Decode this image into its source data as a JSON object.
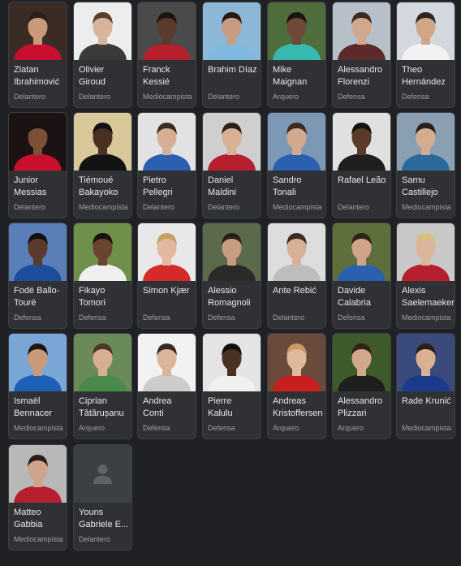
{
  "players": [
    {
      "name": "Zlatan\nIbrahimović",
      "role": "Delantero",
      "bg": "#3a2b24",
      "kit": "#c8102e",
      "skin": "#c89a7a",
      "hair": "#2a1f1a"
    },
    {
      "name": "Olivier\nGiroud",
      "role": "Delantero",
      "bg": "#ededed",
      "kit": "#3a3a3a",
      "skin": "#d8b49a",
      "hair": "#5a3d2b"
    },
    {
      "name": "Franck\nKessié",
      "role": "Mediocampista",
      "bg": "#4a4a4a",
      "kit": "#b51f2e",
      "skin": "#5a3a2a",
      "hair": "#1c1410"
    },
    {
      "name": "Brahim Díaz",
      "role": "Delantero",
      "bg": "#8db7d6",
      "kit": "#7fb8e0",
      "skin": "#c89c82",
      "hair": "#231a15"
    },
    {
      "name": "Mike\nMaignan",
      "role": "Arquero",
      "bg": "#4f6c3c",
      "kit": "#37b9b0",
      "skin": "#6e4a36",
      "hair": "#1a1410"
    },
    {
      "name": "Alessandro\nFlorenzi",
      "role": "Defensa",
      "bg": "#b7c0c8",
      "kit": "#5c2a2a",
      "skin": "#d2a88c",
      "hair": "#3a2a1f"
    },
    {
      "name": "Theo\nHernández",
      "role": "Defensa",
      "bg": "#d3d8de",
      "kit": "#f2f2f2",
      "skin": "#d0a688",
      "hair": "#2f2520"
    },
    {
      "name": "Junior\nMessias",
      "role": "Delantero",
      "bg": "#1b1214",
      "kit": "#c8102e",
      "skin": "#7a5036",
      "hair": "#1a120e"
    },
    {
      "name": "Tiémoué\nBakayoko",
      "role": "Mediocampista",
      "bg": "#d8c89a",
      "kit": "#121212",
      "skin": "#4a3022",
      "hair": "#141010"
    },
    {
      "name": "Pietro\nPellegri",
      "role": "Delantero",
      "bg": "#e2e2e2",
      "kit": "#2b5fb0",
      "skin": "#d6ae94",
      "hair": "#3a2c22"
    },
    {
      "name": "Daniel\nMaldini",
      "role": "Delantero",
      "bg": "#cfcfcf",
      "kit": "#b51f2e",
      "skin": "#d8b094",
      "hair": "#2a201a"
    },
    {
      "name": "Sandro\nTonali",
      "role": "Mediocampista",
      "bg": "#7d98b4",
      "kit": "#2b5fb0",
      "skin": "#d2a88e",
      "hair": "#3a2a20"
    },
    {
      "name": "Rafael Leão",
      "role": "Delantero",
      "bg": "#e0e0e0",
      "kit": "#1e1e1e",
      "skin": "#5a3a28",
      "hair": "#161010"
    },
    {
      "name": "Samu\nCastillejo",
      "role": "Mediocampista",
      "bg": "#8aa0b2",
      "kit": "#2a6a9a",
      "skin": "#d4ac90",
      "hair": "#2a1f18"
    },
    {
      "name": "Fodé Ballo-\nTouré",
      "role": "Defensa",
      "bg": "#5a7fb8",
      "kit": "#1c4e9a",
      "skin": "#5a3a2a",
      "hair": "#161010"
    },
    {
      "name": "Fikayo\nTomori",
      "role": "Defensa",
      "bg": "#6f8f4a",
      "kit": "#f0f0f0",
      "skin": "#6a4430",
      "hair": "#161010"
    },
    {
      "name": "Simon Kjær",
      "role": "Defensa",
      "bg": "#e8e8e8",
      "kit": "#d42a2a",
      "skin": "#e2b8a0",
      "hair": "#c8a060"
    },
    {
      "name": "Alessio\nRomagnoli",
      "role": "Defensa",
      "bg": "#5a6a4a",
      "kit": "#2a2a2a",
      "skin": "#c89c80",
      "hair": "#2a1f18"
    },
    {
      "name": "Ante Rebić",
      "role": "Delantero",
      "bg": "#dddddd",
      "kit": "#bdbdbd",
      "skin": "#d8b096",
      "hair": "#3a2c22"
    },
    {
      "name": "Davide\nCalabria",
      "role": "Defensa",
      "bg": "#5f6f3c",
      "kit": "#2b5fb0",
      "skin": "#d0a488",
      "hair": "#2e2218"
    },
    {
      "name": "Alexis\nSaelemaekers",
      "role": "Mediocampista",
      "bg": "#c8c8c8",
      "kit": "#b51f2e",
      "skin": "#dcb49c",
      "hair": "#d8c080"
    },
    {
      "name": "Ismaël\nBennacer",
      "role": "Mediocampista",
      "bg": "#7aa6d6",
      "kit": "#1e5fb8",
      "skin": "#c89a78",
      "hair": "#1f1812"
    },
    {
      "name": "Ciprian\nTătărușanu",
      "role": "Arquero",
      "bg": "#6a8a5a",
      "kit": "#4a8a4a",
      "skin": "#d6ae92",
      "hair": "#4a3626"
    },
    {
      "name": "Andrea\nConti",
      "role": "Defensa",
      "bg": "#f2f2f2",
      "kit": "#cccccc",
      "skin": "#dcb49a",
      "hair": "#3a2a20"
    },
    {
      "name": "Pierre\nKalulu",
      "role": "Defensa",
      "bg": "#e4e4e4",
      "kit": "#f0f0f0",
      "skin": "#4a3022",
      "hair": "#141010"
    },
    {
      "name": "Andreas\nKristoffersen",
      "role": "Arquero",
      "bg": "#6a4a3a",
      "kit": "#c81e1e",
      "skin": "#e0b89c",
      "hair": "#c89a60"
    },
    {
      "name": "Alessandro\nPlizzari",
      "role": "Arquero",
      "bg": "#3f5a2a",
      "kit": "#1e1e1e",
      "skin": "#d2a88c",
      "hair": "#2f2219"
    },
    {
      "name": "Rade Krunić",
      "role": "Mediocampista",
      "bg": "#3a4a7a",
      "kit": "#1c3a8a",
      "skin": "#d8b094",
      "hair": "#2a1f18"
    },
    {
      "name": "Matteo\nGabbia",
      "role": "Mediocampista",
      "bg": "#b8b8b8",
      "kit": "#b51f2e",
      "skin": "#d0a48a",
      "hair": "#2a1f18"
    },
    {
      "name": "Youns\nGabriele E...",
      "role": "Delantero",
      "bg": "#3c4043",
      "kit": "#5f6368",
      "skin": "#5f6368",
      "hair": "#5f6368",
      "placeholder": true
    }
  ]
}
